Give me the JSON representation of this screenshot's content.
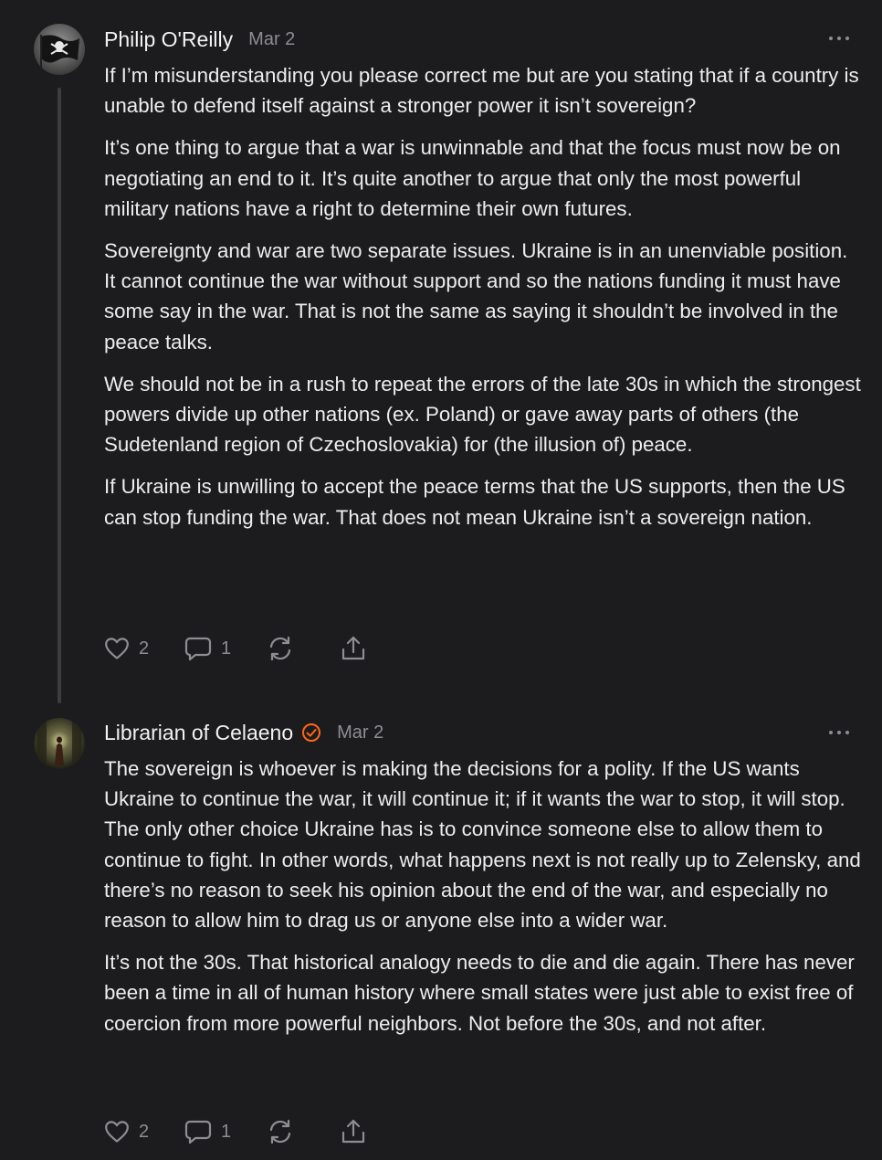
{
  "comments": [
    {
      "author": "Philip O'Reilly",
      "date": "Mar 2",
      "verified": false,
      "avatar_icon": "pirate-flag-icon",
      "paragraphs": [
        "If I’m misunderstanding you please correct me but are you stating that if a country is unable to defend itself against a stronger power it isn’t sovereign?",
        "It’s one thing to argue that a war is unwinnable and that the focus must now be on negotiating an end to it. It’s quite another to argue that only the most powerful military nations have a right to determine their own futures.",
        "Sovereignty and war are two separate issues. Ukraine is in an unenviable position. It cannot continue the war without support and so the nations funding it must have some say in the war. That is not the same as saying it shouldn’t be involved in the peace talks.",
        "We should not be in a rush to repeat the errors of the late 30s in which the strongest powers divide up other nations (ex. Poland) or gave away parts of others (the Sudetenland region of Czechoslovakia) for (the illusion of) peace.",
        "If Ukraine is unwilling to accept the peace terms that the US supports, then the US can stop funding the war. That does not mean Ukraine isn’t a sovereign nation."
      ],
      "likes": "2",
      "replies": "1"
    },
    {
      "author": "Librarian of Celaeno",
      "date": "Mar 2",
      "verified": true,
      "avatar_icon": "dark-corridor-figure-icon",
      "paragraphs": [
        "The sovereign is whoever is making the decisions for a polity. If the US wants Ukraine to continue the war, it will continue it; if it wants the war to stop, it will stop. The only other choice Ukraine has is to convince someone else to allow them to continue to fight. In other words, what happens next is not really up to Zelensky, and there’s no reason to seek his opinion about the end of the war, and especially no reason to allow him to drag us or anyone else into a wider war.",
        "It’s not the 30s. That historical analogy needs to die and die again. There has never been a time in all of human history where small states were just able to exist free of coercion from more powerful neighbors. Not before the 30s, and not after."
      ],
      "likes": "2",
      "replies": "1"
    }
  ],
  "colors": {
    "background": "#1c1c1e",
    "text": "#ededed",
    "muted": "#8d8d93",
    "thread_line": "#3d3d40",
    "verified_badge": "#ff6719"
  },
  "icons": {
    "like": "heart-icon",
    "reply": "speech-bubble-icon",
    "restack": "restack-arrows-icon",
    "share": "share-upload-icon",
    "more": "ellipsis-icon"
  }
}
